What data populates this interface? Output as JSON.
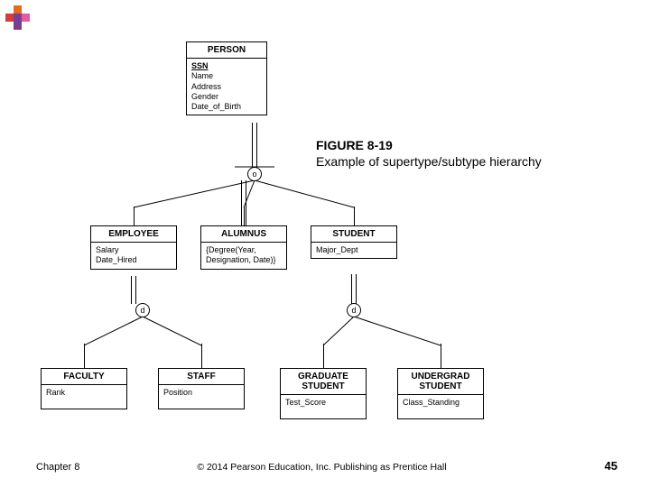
{
  "figure": {
    "number": "FIGURE 8-19",
    "title": "Example of supertype/subtype hierarchy"
  },
  "entities": {
    "person": {
      "name": "PERSON",
      "pk": "SSN",
      "attrs": [
        "Name",
        "Address",
        "Gender",
        "Date_of_Birth"
      ]
    },
    "employee": {
      "name": "EMPLOYEE",
      "attrs": [
        "Salary",
        "Date_Hired"
      ]
    },
    "alumnus": {
      "name": "ALUMNUS",
      "attrs": [
        "{Degree(Year, Designation, Date)}"
      ]
    },
    "student": {
      "name": "STUDENT",
      "attrs": [
        "Major_Dept"
      ]
    },
    "faculty": {
      "name": "FACULTY",
      "attrs": [
        "Rank"
      ]
    },
    "staff": {
      "name": "STAFF",
      "attrs": [
        "Position"
      ]
    },
    "gradstu": {
      "name": "GRADUATE STUDENT",
      "attrs": [
        "Test_Score"
      ]
    },
    "ugradstu": {
      "name": "UNDERGRAD STUDENT",
      "attrs": [
        "Class_Standing"
      ]
    }
  },
  "constraints": {
    "top": "o",
    "leftBranch": "d",
    "rightBranch": "d"
  },
  "footer": {
    "chapter": "Chapter 8",
    "copyright": "© 2014 Pearson Education, Inc. Publishing as Prentice Hall",
    "page": "45"
  },
  "logoColors": {
    "orange": "#e56b1f",
    "red": "#d63c3c",
    "purple": "#7a3e8f",
    "pink": "#e35aa1"
  }
}
